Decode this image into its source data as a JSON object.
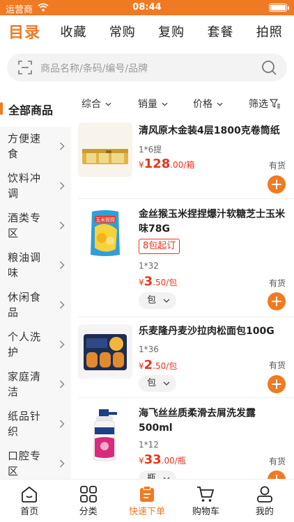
{
  "status_bar": {
    "carrier": "运营商",
    "time": "08:44"
  },
  "top_tabs": [
    "目录",
    "收藏",
    "常购",
    "复购",
    "套餐",
    "拍照"
  ],
  "search": {
    "placeholder": "商品名称/条码/编号/品牌"
  },
  "sidebar": {
    "all_label": "全部商品",
    "items": [
      {
        "line1": "方便速",
        "line2": "食"
      },
      {
        "line1": "饮料冲",
        "line2": "调"
      },
      {
        "line1": "酒类专",
        "line2": "区"
      },
      {
        "line1": "粮油调",
        "line2": "味"
      },
      {
        "line1": "休闲食",
        "line2": "品"
      },
      {
        "line1": "个人洗",
        "line2": "护"
      },
      {
        "line1": "家庭清",
        "line2": "洁"
      },
      {
        "line1": "纸品针",
        "line2": "织"
      },
      {
        "line1": "口腔专",
        "line2": "区"
      }
    ]
  },
  "filters": {
    "sort": "综合",
    "sales": "销量",
    "price": "价格",
    "filter": "筛选"
  },
  "products": [
    {
      "name": "清风原木金装4层1800克卷筒纸",
      "spec": "1*6提",
      "currency": "¥",
      "price_int": "128",
      "price_dec": ".00",
      "unit": "/箱",
      "stock": "有货"
    },
    {
      "name": "金丝猴玉米捏捏爆汁软糖芝士玉米味78G",
      "moq": "8包起订",
      "spec": "1*32",
      "currency": "¥",
      "price_int": "3",
      "price_dec": ".50",
      "unit": "/包",
      "stock": "有货",
      "unit_select": "包",
      "image_text": "玉米捏捏"
    },
    {
      "name": "乐麦隆丹麦沙拉肉松面包100G",
      "spec": "1*36",
      "currency": "¥",
      "price_int": "2",
      "price_dec": ".50",
      "unit": "/包",
      "stock": "有货",
      "unit_select": "包"
    },
    {
      "name": "海飞丝丝质柔滑去屑洗发露500ml",
      "spec": "1*12",
      "currency": "¥",
      "price_int": "33",
      "price_dec": ".00",
      "unit": "/瓶",
      "stock": "有货",
      "unit_select": "瓶"
    }
  ],
  "tab_bar": [
    "首页",
    "分类",
    "快速下单",
    "购物车",
    "我的"
  ],
  "colors": {
    "accent": "#f07a23",
    "price": "#e8341c"
  }
}
